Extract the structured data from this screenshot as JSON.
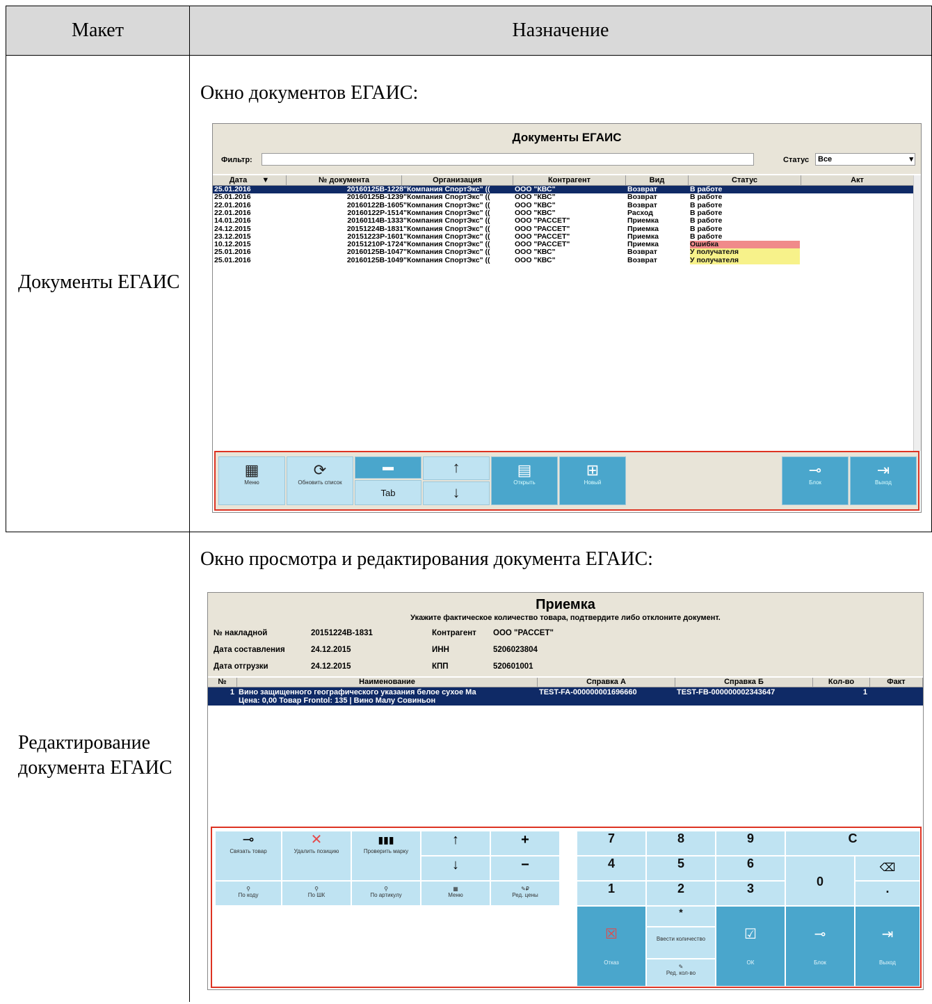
{
  "table": {
    "col1_header": "Макет",
    "col2_header": "Назначение",
    "rows": [
      {
        "label": "Документы ЕГАИС",
        "caption": "Окно документов ЕГАИС:"
      },
      {
        "label": "Редактирование документа ЕГАИС",
        "caption": "Окно просмотра и редактирования документа ЕГАИС:"
      }
    ]
  },
  "win1": {
    "title": "Документы ЕГАИС",
    "filter_label": "Фильтр:",
    "filter_value": "",
    "status_label": "Статус",
    "status_value": "Все",
    "columns": [
      "Дата",
      "№ документа",
      "Организация",
      "Контрагент",
      "Вид",
      "Статус",
      "Акт"
    ],
    "rows": [
      {
        "date": "25.01.2016",
        "doc": "20160125В-1228",
        "org": "\"Компания СпортЭкс\" ((",
        "contr": "ООО \"КВС\"",
        "kind": "Возврат",
        "status": "В работе",
        "status_color": "",
        "act": ""
      },
      {
        "date": "25.01.2016",
        "doc": "20160125В-1239",
        "org": "\"Компания СпортЭкс\" ((",
        "contr": "ООО \"КВС\"",
        "kind": "Возврат",
        "status": "В работе",
        "status_color": "",
        "act": ""
      },
      {
        "date": "22.01.2016",
        "doc": "20160122В-1605",
        "org": "\"Компания СпортЭкс\" ((",
        "contr": "ООО \"КВС\"",
        "kind": "Возврат",
        "status": "В работе",
        "status_color": "",
        "act": ""
      },
      {
        "date": "22.01.2016",
        "doc": "20160122Р-1514",
        "org": "\"Компания СпортЭкс\" ((",
        "contr": "ООО \"КВС\"",
        "kind": "Расход",
        "status": "В работе",
        "status_color": "",
        "act": ""
      },
      {
        "date": "14.01.2016",
        "doc": "20160114В-1333",
        "org": "\"Компания СпортЭкс\" ((",
        "contr": "ООО \"РАССЕТ\"",
        "kind": "Приемка",
        "status": "В работе",
        "status_color": "",
        "act": ""
      },
      {
        "date": "24.12.2015",
        "doc": "20151224В-1831",
        "org": "\"Компания СпортЭкс\" ((",
        "contr": "ООО \"РАССЕТ\"",
        "kind": "Приемка",
        "status": "В работе",
        "status_color": "",
        "act": ""
      },
      {
        "date": "23.12.2015",
        "doc": "20151223Р-1601",
        "org": "\"Компания СпортЭкс\" ((",
        "contr": "ООО \"РАССЕТ\"",
        "kind": "Приемка",
        "status": "В работе",
        "status_color": "",
        "act": ""
      },
      {
        "date": "10.12.2015",
        "doc": "20151210Р-1724",
        "org": "\"Компания СпортЭкс\" ((",
        "contr": "ООО \"РАССЕТ\"",
        "kind": "Приемка",
        "status": "Ошибка",
        "status_color": "#f08a8a",
        "act": ""
      },
      {
        "date": "25.01.2016",
        "doc": "20160125В-1047",
        "org": "\"Компания СпортЭкс\" ((",
        "contr": "ООО \"КВС\"",
        "kind": "Возврат",
        "status": "У получателя",
        "status_color": "#f7f28a",
        "act": ""
      },
      {
        "date": "25.01.2016",
        "doc": "20160125В-1049",
        "org": "\"Компания СпортЭкс\" ((",
        "contr": "ООО \"КВС\"",
        "kind": "Возврат",
        "status": "У получателя",
        "status_color": "#f7f28a",
        "act": ""
      }
    ],
    "buttons": {
      "menu": "Меню",
      "refresh": "Обновить список",
      "tab": "Tab",
      "open": "Открыть",
      "new": "Новый",
      "lock": "Блок",
      "exit": "Выход"
    }
  },
  "win2": {
    "title": "Приемка",
    "subtitle": "Укажите фактическое количество товара, подтвердите либо отклоните документ.",
    "invoice_label": "№ накладной",
    "invoice_value": "20151224В-1831",
    "contr_label": "Контрагент",
    "contr_value": "ООО \"РАССЕТ\"",
    "date_made_label": "Дата составления",
    "date_made_value": "24.12.2015",
    "inn_label": "ИНН",
    "inn_value": "5206023804",
    "date_ship_label": "Дата отгрузки",
    "date_ship_value": "24.12.2015",
    "kpp_label": "КПП",
    "kpp_value": "520601001",
    "columns": [
      "№",
      "Наименование",
      "Справка А",
      "Справка Б",
      "Кол-во",
      "Факт"
    ],
    "row": {
      "num": "1",
      "name1": "Вино защищенного географического указания белое сухое Ма",
      "name2": "Цена: 0,00 Товар Frontol: 135 | Вино Малу Совиньон",
      "refA": "TEST-FA-000000001696660",
      "refB": "TEST-FB-000000002343647",
      "qty": "1",
      "fact": ""
    },
    "buttons": {
      "link": "Связать товар",
      "delete": "Удалить позицию",
      "check": "Проверить марку",
      "by_code": "По коду",
      "by_barcode": "По ШК",
      "by_article": "По артикулу",
      "menu": "Меню",
      "edit_price": "Ред. цены",
      "reject": "Отказ",
      "enter_qty": "Ввести количество",
      "edit_qty": "Ред. кол-во",
      "ok": "ОК",
      "lock": "Блок",
      "exit": "Выход",
      "asterisk": "*",
      "clear": "C",
      "dot": ".",
      "zero": "0",
      "keys": [
        "7",
        "8",
        "9",
        "4",
        "5",
        "6",
        "1",
        "2",
        "3"
      ]
    }
  }
}
